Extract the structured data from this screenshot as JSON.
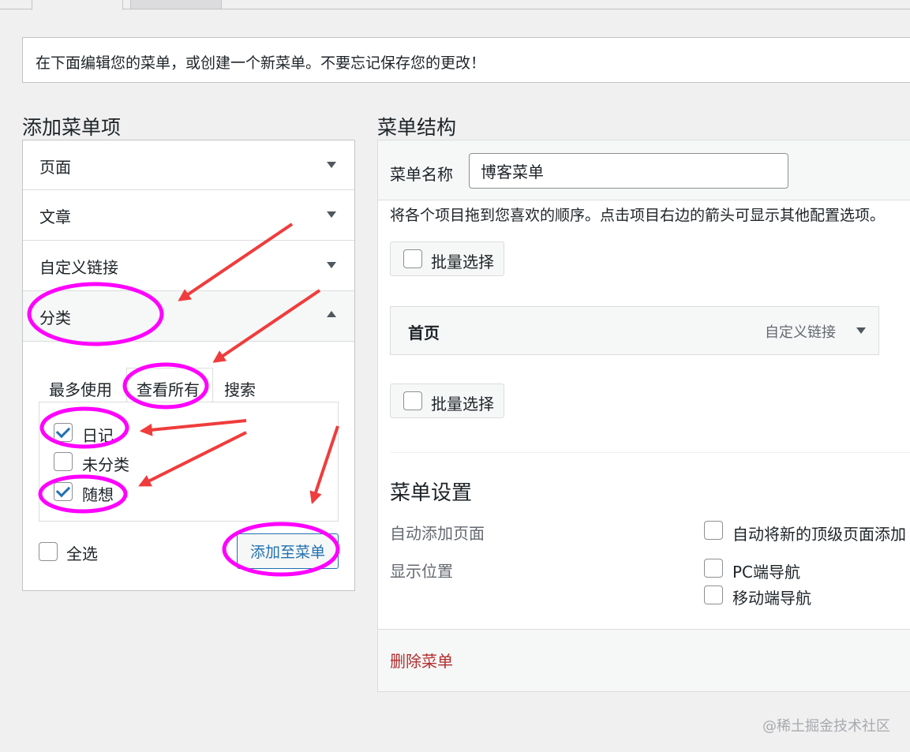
{
  "notice": {
    "text": "在下面编辑您的菜单，或创建一个新菜单。不要忘记保存您的更改！"
  },
  "left": {
    "heading": "添加菜单项",
    "sections": [
      {
        "label": "页面",
        "state": "collapsed"
      },
      {
        "label": "文章",
        "state": "collapsed"
      },
      {
        "label": "自定义链接",
        "state": "collapsed"
      },
      {
        "label": "分类",
        "state": "expanded"
      }
    ],
    "category_tabs": [
      {
        "label": "最多使用",
        "active": false
      },
      {
        "label": "查看所有",
        "active": true
      },
      {
        "label": "搜索",
        "active": false
      }
    ],
    "categories": [
      {
        "label": "日记",
        "checked": true
      },
      {
        "label": "未分类",
        "checked": false
      },
      {
        "label": "随想",
        "checked": true
      }
    ],
    "select_all_label": "全选",
    "add_button_label": "添加至菜单"
  },
  "right": {
    "heading": "菜单结构",
    "menu_name_label": "菜单名称",
    "menu_name_value": "博客菜单",
    "help_text": "将各个项目拖到您喜欢的顺序。点击项目右边的箭头可显示其他配置选项。",
    "bulk_select_label": "批量选择",
    "menu_items": [
      {
        "title": "首页",
        "type": "自定义链接"
      }
    ],
    "settings": {
      "heading": "菜单设置",
      "auto_add_label": "自动添加页面",
      "auto_add_option": "自动将新的顶级页面添加",
      "location_label": "显示位置",
      "locations": [
        {
          "label": "PC端导航",
          "checked": false
        },
        {
          "label": "移动端导航",
          "checked": false
        }
      ]
    },
    "delete_label": "删除菜单"
  },
  "watermark": "@稀土掘金技术社区",
  "colors": {
    "accent": "#2271b1",
    "danger": "#b32d2e",
    "annotation_magenta": "#ff00ff",
    "annotation_arrow": "#f03c3c"
  },
  "icons": {
    "collapsed": "triangle-down",
    "expanded": "triangle-up",
    "checkbox_checked": "checkmark"
  }
}
